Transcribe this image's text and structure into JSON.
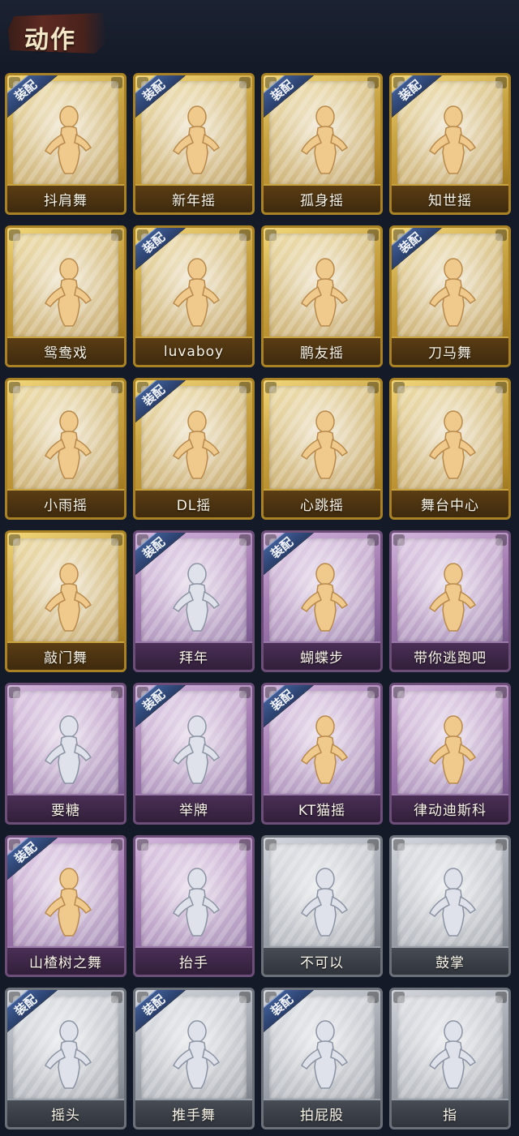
{
  "header": {
    "title": "动作"
  },
  "colors": {
    "gold": "#c9a440",
    "purple": "#9c79ab",
    "gray": "#9aa0a9",
    "badge": "#2f477a",
    "figure_gold": "#f0c98c"
  },
  "cards": [
    {
      "name": "抖肩舞",
      "rarity": "gold",
      "equipped": "装配",
      "figure": "gold"
    },
    {
      "name": "新年摇",
      "rarity": "gold",
      "equipped": "装配",
      "figure": "gold"
    },
    {
      "name": "孤身摇",
      "rarity": "gold",
      "equipped": "装配",
      "figure": "gold"
    },
    {
      "name": "知世摇",
      "rarity": "gold",
      "equipped": "装配",
      "figure": "gold"
    },
    {
      "name": "鸳鸯戏",
      "rarity": "gold",
      "equipped": "",
      "figure": "gold"
    },
    {
      "name": "luvaboy",
      "rarity": "gold",
      "equipped": "装配",
      "figure": "gold"
    },
    {
      "name": "鹏友摇",
      "rarity": "gold",
      "equipped": "",
      "figure": "gold"
    },
    {
      "name": "刀马舞",
      "rarity": "gold",
      "equipped": "装配",
      "figure": "gold"
    },
    {
      "name": "小雨摇",
      "rarity": "gold",
      "equipped": "",
      "figure": "gold"
    },
    {
      "name": "DL摇",
      "rarity": "gold",
      "equipped": "装配",
      "figure": "gold"
    },
    {
      "name": "心跳摇",
      "rarity": "gold",
      "equipped": "",
      "figure": "gold"
    },
    {
      "name": "舞台中心",
      "rarity": "gold",
      "equipped": "",
      "figure": "gold"
    },
    {
      "name": "敲门舞",
      "rarity": "gold",
      "equipped": "",
      "figure": "gold"
    },
    {
      "name": "拜年",
      "rarity": "purple",
      "equipped": "装配",
      "figure": "silver"
    },
    {
      "name": "蝴蝶步",
      "rarity": "purple",
      "equipped": "装配",
      "figure": "gold"
    },
    {
      "name": "带你逃跑吧",
      "rarity": "purple",
      "equipped": "",
      "figure": "gold"
    },
    {
      "name": "要糖",
      "rarity": "purple",
      "equipped": "",
      "figure": "silver"
    },
    {
      "name": "举牌",
      "rarity": "purple",
      "equipped": "装配",
      "figure": "silver"
    },
    {
      "name": "KT猫摇",
      "rarity": "purple",
      "equipped": "装配",
      "figure": "gold"
    },
    {
      "name": "律动迪斯科",
      "rarity": "purple",
      "equipped": "",
      "figure": "gold"
    },
    {
      "name": "山楂树之舞",
      "rarity": "purple",
      "equipped": "装配",
      "figure": "gold"
    },
    {
      "name": "抬手",
      "rarity": "purple",
      "equipped": "",
      "figure": "silver"
    },
    {
      "name": "不可以",
      "rarity": "gray",
      "equipped": "",
      "figure": "silver"
    },
    {
      "name": "鼓掌",
      "rarity": "gray",
      "equipped": "",
      "figure": "silver"
    },
    {
      "name": "摇头",
      "rarity": "gray",
      "equipped": "装配",
      "figure": "silver"
    },
    {
      "name": "推手舞",
      "rarity": "gray",
      "equipped": "装配",
      "figure": "silver"
    },
    {
      "name": "拍屁股",
      "rarity": "gray",
      "equipped": "装配",
      "figure": "silver"
    },
    {
      "name": "指",
      "rarity": "gray",
      "equipped": "",
      "figure": "silver"
    }
  ]
}
